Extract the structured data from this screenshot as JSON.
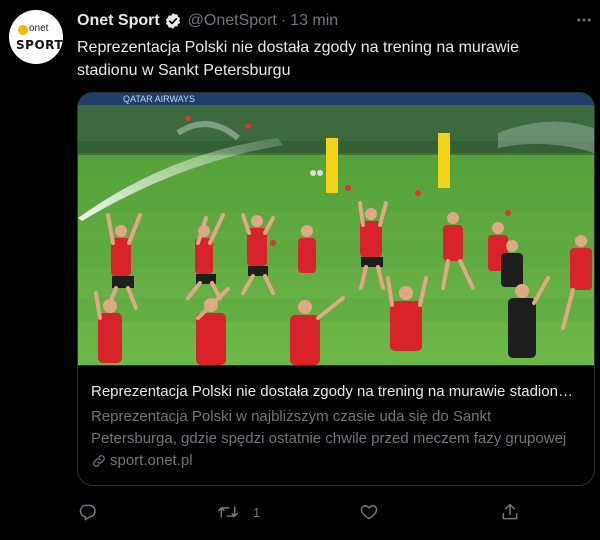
{
  "tweet": {
    "author_name": "Onet Sport",
    "handle": "@OnetSport",
    "separator": "·",
    "time": "13 min",
    "avatar": {
      "small_text": "onet",
      "big_text": "SPORT"
    },
    "verified_icon": "verified-badge-icon",
    "more_icon": "more-options-icon",
    "text_line1": "Reprezentacja Polski nie dostała zgody na trening na murawie",
    "text_line2": "stadionu w Sankt Petersburgu"
  },
  "card": {
    "photo_banner": "QATAR AIRWAYS",
    "title": "Reprezentacja Polski nie dostała zgody na trening na murawie stadionu w Sankt Petersburgu",
    "desc_line1": "Reprezentacja Polski w najbliższym czasie uda się do Sankt",
    "desc_line2": "Petersburga, gdzie spędzi ostatnie chwile przed meczem fazy grupowej",
    "domain": "sport.onet.pl",
    "link_icon": "link-icon"
  },
  "actions": {
    "reply_icon": "reply-icon",
    "retweet_icon": "retweet-icon",
    "retweet_count": "1",
    "like_icon": "heart-icon",
    "share_icon": "share-icon"
  },
  "colors": {
    "background": "#000000",
    "text_primary": "#e7e9ea",
    "text_secondary": "#71767b",
    "border": "#2f3336",
    "verified": "#1d9bf0",
    "pitch_green": "#5aa83e"
  }
}
